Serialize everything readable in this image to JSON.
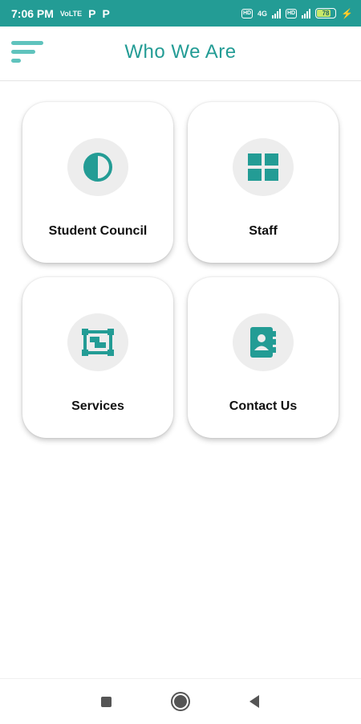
{
  "status_bar": {
    "time": "7:06 PM",
    "carrier_badge": "Vo ltE",
    "notif_1": "P",
    "notif_2": "P",
    "sim1": "4G",
    "sim2": "4G",
    "battery": "78",
    "colors": {
      "background": "#239c95",
      "text": "#ffffff"
    }
  },
  "header": {
    "title": "Who We Are",
    "menu_icon": "menu-lines-icon"
  },
  "cards": [
    {
      "label": "Student Council",
      "icon": "half-circle-contrast-icon"
    },
    {
      "label": "Staff",
      "icon": "grid-four-squares-icon"
    },
    {
      "label": "Services",
      "icon": "frame-board-icon"
    },
    {
      "label": "Contact Us",
      "icon": "contact-book-icon"
    }
  ],
  "nav_bar": {
    "icons": [
      "recent-apps-square-icon",
      "home-circle-icon",
      "back-triangle-icon"
    ]
  },
  "colors": {
    "accent": "#239c95",
    "menu_icon": "#5fc3bd",
    "icon_bg": "#ededed",
    "card_text": "#111111"
  }
}
